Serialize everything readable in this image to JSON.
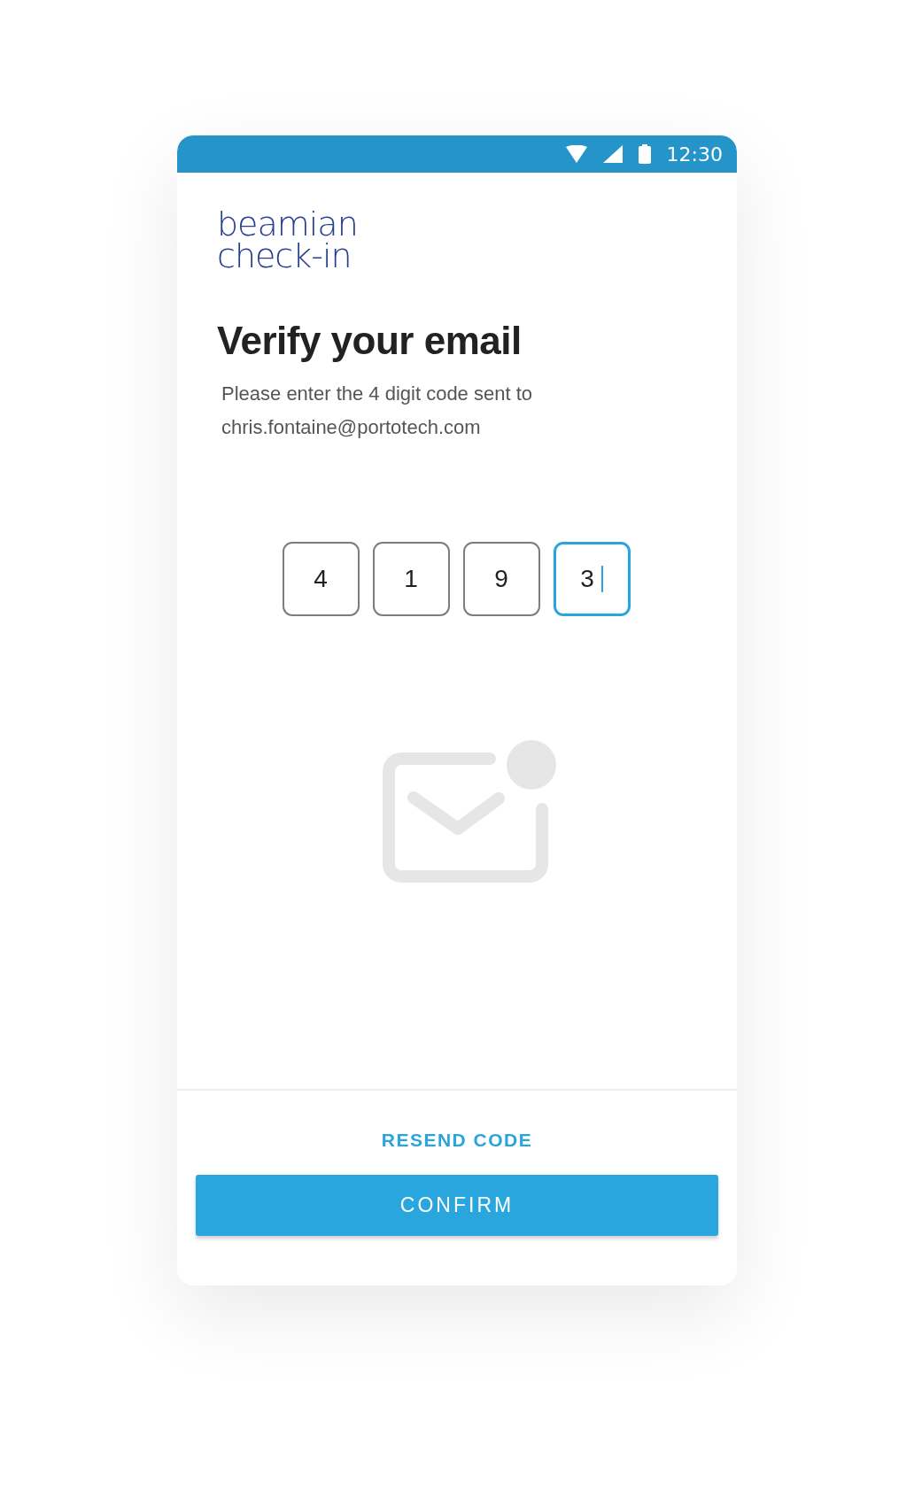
{
  "status_bar": {
    "time": "12:30"
  },
  "logo": {
    "lines": [
      "beamian",
      "check-in"
    ]
  },
  "title": "Verify your email",
  "message": [
    "Please enter the 4 digit code sent to",
    "chris.fontaine@portotech.com"
  ],
  "code_digits": [
    {
      "value": "4",
      "focused": false
    },
    {
      "value": "1",
      "focused": false
    },
    {
      "value": "9",
      "focused": false
    },
    {
      "value": "3",
      "focused": true
    }
  ],
  "resend_link": "RESEND CODE",
  "confirm_button": "CONFIRM"
}
